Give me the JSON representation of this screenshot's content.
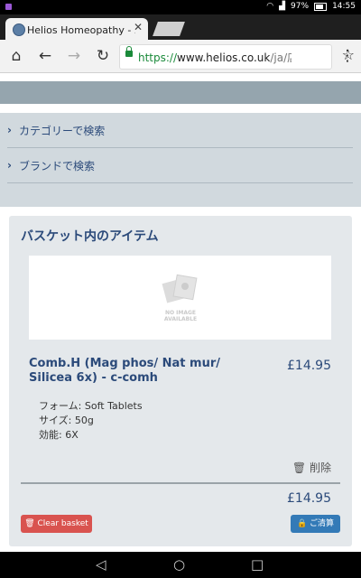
{
  "status_bar": {
    "signal": "97%",
    "time": "14:55"
  },
  "browser": {
    "tab_title": "Helios Homeopathy - バスケ",
    "tab_close": "✕",
    "url_scheme": "https://",
    "url_host": "www.helios.co.uk",
    "url_path": "/ja/店舗/"
  },
  "search": {
    "items": [
      {
        "label": "カテゴリーで検索"
      },
      {
        "label": "ブランドで検索"
      }
    ]
  },
  "basket": {
    "title": "バスケット内のアイテム",
    "no_image_text": "NO IMAGE AVAILABLE",
    "item": {
      "name": "Comb.H (Mag phos/ Nat mur/ Silicea 6x) - c-comh",
      "price": "£14.95",
      "attributes": [
        {
          "label": "フォーム:",
          "value": "Soft Tablets"
        },
        {
          "label": "サイズ:",
          "value": "50g"
        },
        {
          "label": "効能:",
          "value": "6X"
        }
      ],
      "remove_label": "削除"
    },
    "total": "£14.95",
    "clear_label": "Clear basket",
    "checkout_label": "ご清算"
  },
  "colors": {
    "accent": "#2b4a7a",
    "danger": "#d9534f",
    "primary": "#337ab7"
  }
}
